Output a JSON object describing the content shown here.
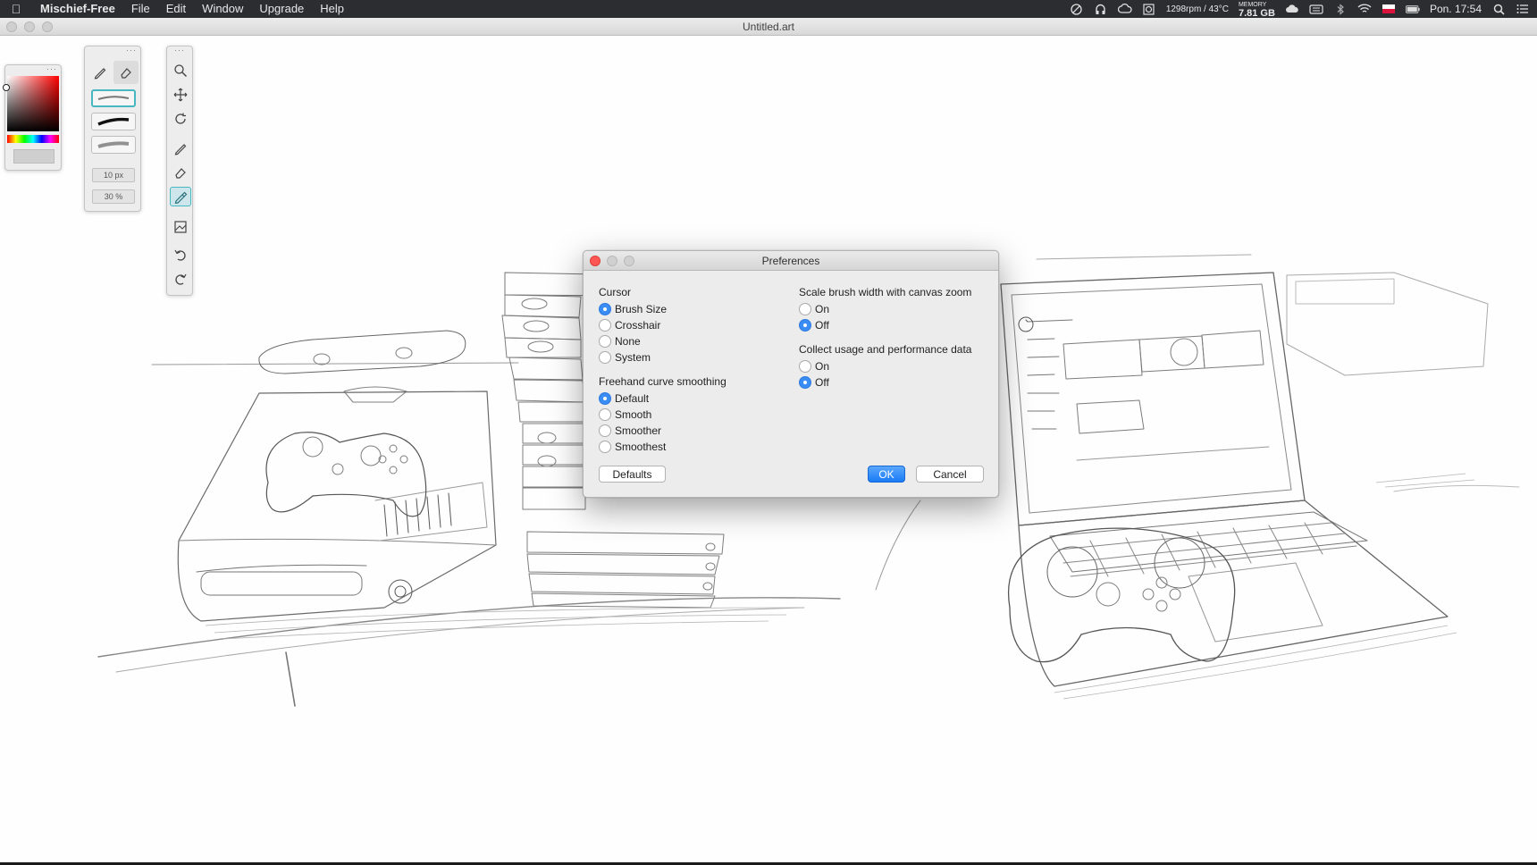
{
  "menubar": {
    "app_name": "Mischief-Free",
    "menus": [
      "File",
      "Edit",
      "Window",
      "Upgrade",
      "Help"
    ],
    "status": {
      "fan_temp": "1298rpm / 43°C",
      "memory_label": "MEMORY",
      "memory_value": "7.81 GB",
      "clock": "Pon. 17:54"
    }
  },
  "window": {
    "title": "Untitled.art"
  },
  "brush_palette": {
    "size": "10 px",
    "opacity": "30 %"
  },
  "dialog": {
    "title": "Preferences",
    "cursor": {
      "heading": "Cursor",
      "options": [
        "Brush Size",
        "Crosshair",
        "None",
        "System"
      ],
      "selected": "Brush Size"
    },
    "smoothing": {
      "heading": "Freehand curve smoothing",
      "options": [
        "Default",
        "Smooth",
        "Smoother",
        "Smoothest"
      ],
      "selected": "Default"
    },
    "scale": {
      "heading": "Scale brush width with canvas zoom",
      "options": [
        "On",
        "Off"
      ],
      "selected": "Off"
    },
    "usage": {
      "heading": "Collect usage and performance data",
      "options": [
        "On",
        "Off"
      ],
      "selected": "Off"
    },
    "buttons": {
      "defaults": "Defaults",
      "ok": "OK",
      "cancel": "Cancel"
    }
  }
}
